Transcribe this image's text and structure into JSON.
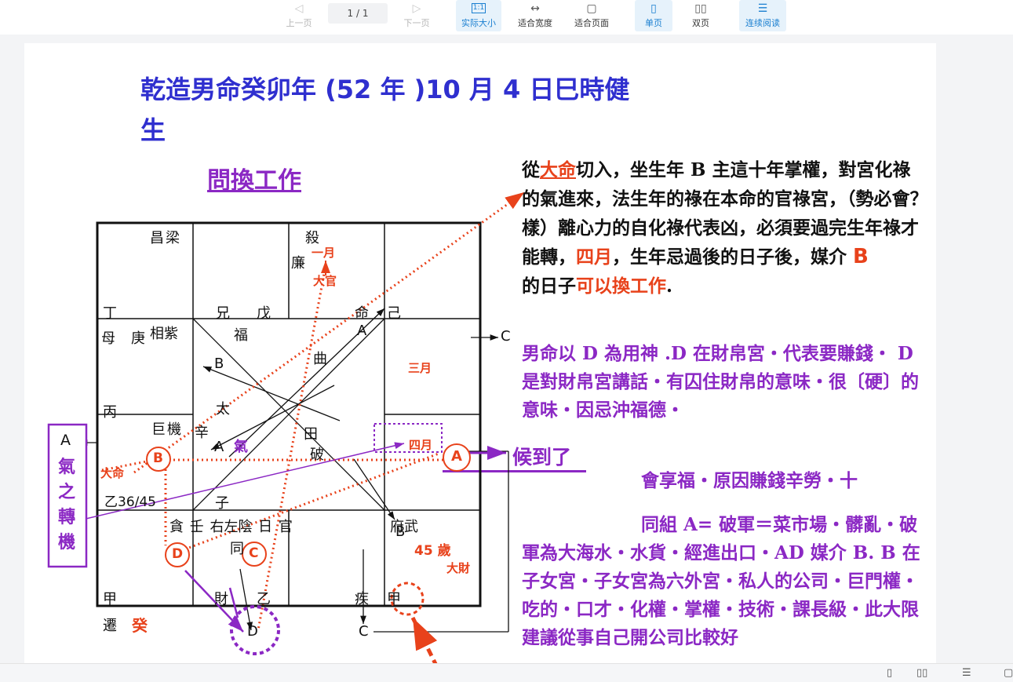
{
  "toolbar": {
    "prev_label": "上一页",
    "page_indicator": "1 / 1",
    "next_label": "下一页",
    "actual_size_label": "实际大小",
    "actual_size_icon_text": "1:1",
    "fit_width_label": "适合宽度",
    "fit_page_label": "适合页面",
    "single_page_label": "单页",
    "double_page_label": "双页",
    "continuous_label": "连续阅读"
  },
  "document": {
    "title_line1": "乾造男命癸卯年 (52 年 )10 月 4 日巳時健",
    "title_line2": "生",
    "subtitle": "問換工作",
    "para1": {
      "p1": "從",
      "p2": "大命",
      "p3": "切入，坐生年 B  主這十年掌權，對宮化祿的氣進來，法生年的祿在本命的官祿宮，（勢必會？樣）離心力的自化祿代表凶，必須要過完生年祿才能轉，",
      "p4": "四月",
      "p5": "，生年忌過後的日子後，媒介 ",
      "p6": "B",
      "p7": "的日子",
      "p8": "可以換工作",
      "p9": "."
    },
    "para2": "男命以 D 為用神 .D 在財帛宮・代表要賺錢・ D 是對財帛宮講話・有囚住財帛的意味・很〔硬〕的意味・因忌沖福德・",
    "wait_label": "候到了",
    "para3": "會享福・原因賺錢辛勞・十",
    "para4": "同組 A= 破軍＝菜市場・髒亂・破軍為大海水・水貨・經進出口・AD 媒介 B. B 在子女宮・子女宮為六外宮・私人的公司・巨門權・吃的・口才・化權・掌權・技術・課長級・此大限",
    "para4_tail": "建議從事自己開公司比較好"
  },
  "chart": {
    "left_box_letter": "A",
    "left_box_text": "氣之轉機",
    "cells": {
      "r1c1_star": "昌梁",
      "r1c1_stem": "丁",
      "r1c2_palace": "兄",
      "r1c2_stem": "戊",
      "r1c3_star1": "殺",
      "r1c3_star2": "廉",
      "r1c3_month": "一月",
      "r1c3_big": "大官",
      "r1c3_palace": "命",
      "r1c4_stem": "己",
      "r2c1_palace": "母",
      "r2c1_stem": "庚",
      "r2c1_star": "相紫",
      "r2c4_month": "三月",
      "r3c1_star": "巨機",
      "r3c1_stem": "丙",
      "r3c4_month": "四月",
      "r4c1_stem": "甲",
      "r4c1_palace": "遷",
      "r4c1_year": "癸",
      "r4c2_palace": "財",
      "r4c2_stem": "乙",
      "r4c4_palace": "疾",
      "r4c4_stem": "甲",
      "r4c4_age": "45 歲",
      "r4c4_big": "大財",
      "r4c4_star": "府武",
      "r3c1_age": "乙36/45",
      "r3c1_big": "大命",
      "center_fu": "福",
      "center_qu": "曲",
      "center_tai": "太",
      "center_xin": "辛",
      "center_qi": "氣",
      "center_tian": "田",
      "center_po": "破",
      "center_zi": "子",
      "bottom_row": "貪 壬 右左陰 日 官",
      "bottom_tong": "同"
    },
    "letters": {
      "A_top": "A",
      "B_top": "B",
      "A_mid": "A",
      "B_mid": "B",
      "C_right": "C",
      "C_bottom": "C",
      "D_bottom": "D",
      "circle_A": "A",
      "circle_B": "B",
      "circle_C": "C",
      "circle_D": "D"
    },
    "colors": {
      "red": "#e8421b",
      "purple": "#8b28c4",
      "blue": "#2f2fcf"
    }
  }
}
